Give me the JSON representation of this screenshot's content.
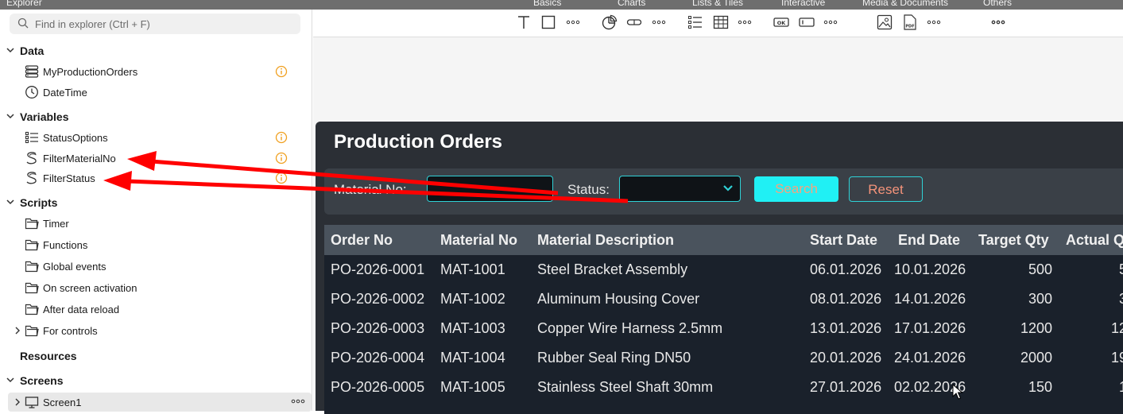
{
  "header": {
    "title": "Explorer",
    "toolbar_groups": [
      "Basics",
      "Charts",
      "Lists & Tiles",
      "Interactive",
      "Media & Documents",
      "Others"
    ]
  },
  "explorer": {
    "search_placeholder": "Find in explorer (Ctrl + F)",
    "sections": {
      "data": "Data",
      "variables": "Variables",
      "scripts": "Scripts",
      "resources": "Resources",
      "screens": "Screens"
    },
    "data_items": [
      "MyProductionOrders",
      "DateTime"
    ],
    "variable_items": [
      "StatusOptions",
      "FilterMaterialNo",
      "FilterStatus"
    ],
    "script_items": [
      "Timer",
      "Functions",
      "Global events",
      "On screen activation",
      "After data reload",
      "For controls"
    ],
    "screen_items": [
      "Screen1"
    ]
  },
  "ribbon": {
    "icons": [
      "text-icon",
      "rectangle-icon",
      "more-icon",
      "pie-chart-icon",
      "progress-icon",
      "more-icon",
      "list-icon",
      "table-icon",
      "more-icon",
      "ok-button-icon",
      "textbox-icon",
      "more-icon",
      "image-icon",
      "pdf-icon",
      "more-icon",
      "more-icon"
    ]
  },
  "app": {
    "title": "Production Orders",
    "filter": {
      "material_label": "Material No:",
      "status_label": "Status:",
      "search_label": "Search",
      "reset_label": "Reset"
    },
    "columns": [
      "Order No",
      "Material No",
      "Material Description",
      "Start Date",
      "End Date",
      "Target Qty",
      "Actual Q"
    ],
    "rows": [
      [
        "PO-2026-0001",
        "MAT-1001",
        "Steel Bracket Assembly",
        "06.01.2026",
        "10.01.2026",
        "500",
        "5"
      ],
      [
        "PO-2026-0002",
        "MAT-1002",
        "Aluminum Housing Cover",
        "08.01.2026",
        "14.01.2026",
        "300",
        "3"
      ],
      [
        "PO-2026-0003",
        "MAT-1003",
        "Copper Wire Harness 2.5mm",
        "13.01.2026",
        "17.01.2026",
        "1200",
        "12"
      ],
      [
        "PO-2026-0004",
        "MAT-1004",
        "Rubber Seal Ring DN50",
        "20.01.2026",
        "24.01.2026",
        "2000",
        "19"
      ],
      [
        "PO-2026-0005",
        "MAT-1005",
        "Stainless Steel Shaft 30mm",
        "27.01.2026",
        "02.02.2026",
        "150",
        "1"
      ]
    ]
  },
  "colors": {
    "accent": "#2fd1d6",
    "search_button": "#20f0f4",
    "button_text": "#f4937a",
    "annotation_arrow": "#ff0000",
    "info_icon": "#f0a020"
  }
}
